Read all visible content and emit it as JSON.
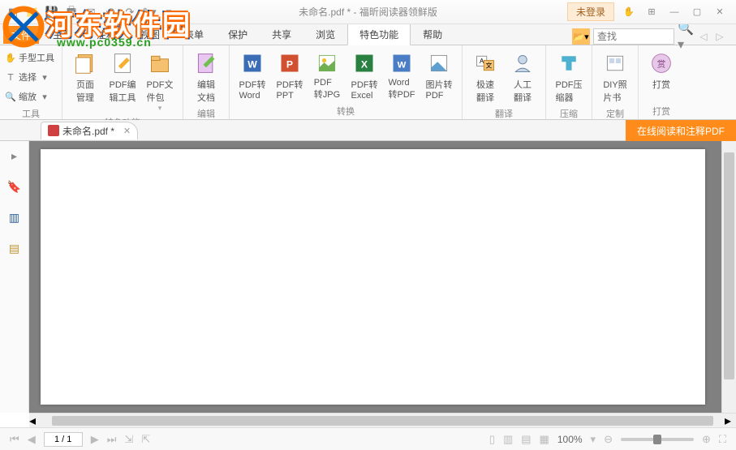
{
  "watermark": {
    "site_name": "河东软件园",
    "url": "www.pc0359.cn"
  },
  "titlebar": {
    "title": "未命名.pdf * - 福昕阅读器领鲜版",
    "login_label": "未登录"
  },
  "file_tab": "文件",
  "tabs": [
    "主页",
    "注释",
    "视图",
    "表单",
    "保护",
    "共享",
    "浏览",
    "特色功能",
    "帮助"
  ],
  "active_tab_index": 7,
  "search": {
    "placeholder": "查找"
  },
  "ribbon": {
    "tools": {
      "hand": "手型工具",
      "select": "选择",
      "zoom": "缩放",
      "group_label": "工具"
    },
    "feature": {
      "page_mgmt": "页面\n管理",
      "pdf_edit_tool": "PDF编\n辑工具",
      "pdf_package": "PDF文\n件包",
      "group_label": "特色功能"
    },
    "edit": {
      "edit_doc": "编辑\n文档",
      "group_label": "编辑"
    },
    "convert": {
      "to_word": "PDF转\nWord",
      "to_ppt": "PDF转\nPPT",
      "to_jpg": "PDF\n转JPG",
      "to_excel": "PDF转\nExcel",
      "word_to_pdf": "Word\n转PDF",
      "img_to_pdf": "图片转\nPDF",
      "group_label": "转换"
    },
    "translate": {
      "fast": "极速\n翻译",
      "human": "人工\n翻译",
      "group_label": "翻译"
    },
    "compress": {
      "compress": "PDF压\n缩器",
      "group_label": "压缩"
    },
    "custom": {
      "diy": "DIY照\n片书",
      "group_label": "定制"
    },
    "reward": {
      "reward": "打赏",
      "group_label": "打赏"
    }
  },
  "doc_tab": {
    "name": "未命名.pdf *"
  },
  "online_annotate": "在线阅读和注释PDF",
  "statusbar": {
    "page": "1 / 1",
    "zoom": "100%"
  }
}
